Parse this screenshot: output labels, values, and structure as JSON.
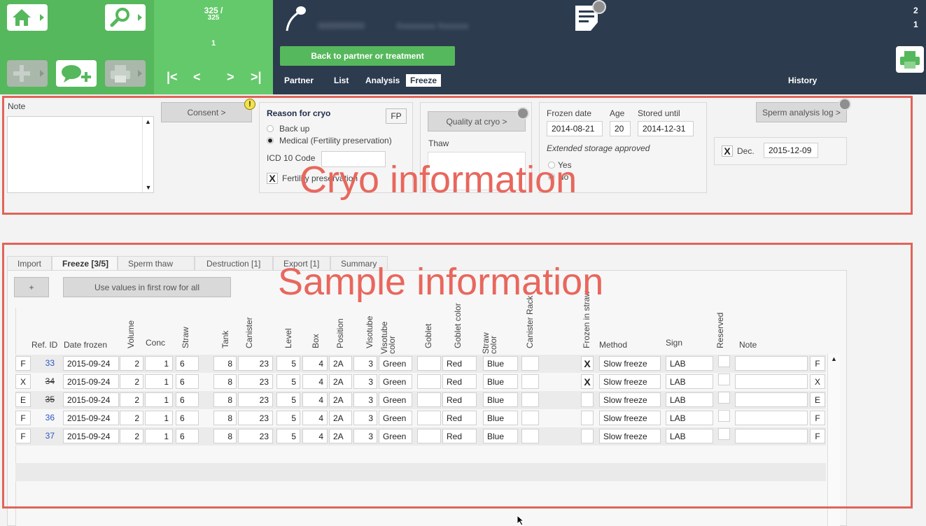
{
  "nav": {
    "counter_top": "325 /",
    "counter_total": "325",
    "counter_current": "1",
    "first_icon": "first-page-icon",
    "prev_icon": "prev-page-icon",
    "next_icon": "next-page-icon",
    "last_icon": "last-page-icon"
  },
  "header": {
    "back_button": "Back to partner or treatment",
    "tabs": [
      "Partner",
      "List",
      "Analysis",
      "Freeze"
    ],
    "active_tab": "Freeze",
    "history": "History",
    "right_numbers": [
      "2",
      "1"
    ]
  },
  "cryo": {
    "note_label": "Note",
    "consent_button": "Consent >",
    "warning_glyph": "!",
    "reason_title": "Reason for cryo",
    "fp_button": "FP",
    "reason_options": [
      "Back up",
      "Medical (Fertility preservation)"
    ],
    "reason_selected": 1,
    "icd_label": "ICD 10 Code",
    "icd_value": "",
    "fertility_label": "Fertility preservation",
    "fertility_checked": "X",
    "quality_button": "Quality at cryo >",
    "thaw_label": "Thaw",
    "frozen_date_label": "Frozen date",
    "frozen_date": "2014-08-21",
    "age_label": "Age",
    "age_value": "20",
    "stored_until_label": "Stored until",
    "stored_until": "2014-12-31",
    "extended_label": "Extended storage approved",
    "extended_options": [
      "Yes",
      "No"
    ],
    "extended_selected": 1,
    "sperm_log_button": "Sperm analysis log >",
    "dec_checked": "X",
    "dec_label": "Dec.",
    "dec_date": "2015-12-09"
  },
  "overlays": {
    "cryo_title": "Cryo information",
    "sample_title": "Sample information"
  },
  "sample": {
    "tabs": [
      "Import",
      "Freeze [3/5]",
      "Sperm thaw",
      "Destruction [1]",
      "Export [1]",
      "Summary"
    ],
    "active_tab": "Freeze [3/5]",
    "add_button": "+",
    "use_values_button": "Use values in first row for all",
    "columns": {
      "ref_id": "Ref. ID",
      "date_frozen": "Date frozen",
      "volume": "Volume",
      "conc": "Conc",
      "straw": "Straw",
      "tank": "Tank",
      "canister": "Canister",
      "level": "Level",
      "box": "Box",
      "position": "Position",
      "visotube": "Visotube",
      "visotube_color": "Visotube color",
      "goblet": "Goblet",
      "goblet_color": "Goblet color",
      "straw_color": "Straw color",
      "canister_rack": "Canister Rack",
      "frozen_in_straw": "Frozen in straw",
      "method": "Method",
      "sign": "Sign",
      "reserved": "Reserved",
      "note": "Note"
    },
    "rows": [
      {
        "flag": "F",
        "ref": "33",
        "ref_style": "link",
        "date": "2015-09-24",
        "volume": "2",
        "conc": "1",
        "straw": "6",
        "tank": "8",
        "canister": "23",
        "level": "5",
        "box": "4",
        "position": "2A",
        "visotube": "3",
        "visotube_color": "Green",
        "goblet": "",
        "goblet_color": "Red",
        "straw_color": "Blue",
        "canister_rack": "",
        "frozen": "X",
        "method": "Slow freeze",
        "sign": "LAB",
        "reserved": "",
        "note": "",
        "end_flag": "F"
      },
      {
        "flag": "X",
        "ref": "34",
        "ref_style": "struck",
        "date": "2015-09-24",
        "volume": "2",
        "conc": "1",
        "straw": "6",
        "tank": "8",
        "canister": "23",
        "level": "5",
        "box": "4",
        "position": "2A",
        "visotube": "3",
        "visotube_color": "Green",
        "goblet": "",
        "goblet_color": "Red",
        "straw_color": "Blue",
        "canister_rack": "",
        "frozen": "X",
        "method": "Slow freeze",
        "sign": "LAB",
        "reserved": "",
        "note": "",
        "end_flag": "X"
      },
      {
        "flag": "E",
        "ref": "35",
        "ref_style": "struck",
        "date": "2015-09-24",
        "volume": "2",
        "conc": "1",
        "straw": "6",
        "tank": "8",
        "canister": "23",
        "level": "5",
        "box": "4",
        "position": "2A",
        "visotube": "3",
        "visotube_color": "Green",
        "goblet": "",
        "goblet_color": "Red",
        "straw_color": "Blue",
        "canister_rack": "",
        "frozen": "",
        "method": "Slow freeze",
        "sign": "LAB",
        "reserved": "",
        "note": "",
        "end_flag": "E"
      },
      {
        "flag": "F",
        "ref": "36",
        "ref_style": "link",
        "date": "2015-09-24",
        "volume": "2",
        "conc": "1",
        "straw": "6",
        "tank": "8",
        "canister": "23",
        "level": "5",
        "box": "4",
        "position": "2A",
        "visotube": "3",
        "visotube_color": "Green",
        "goblet": "",
        "goblet_color": "Red",
        "straw_color": "Blue",
        "canister_rack": "",
        "frozen": "",
        "method": "Slow freeze",
        "sign": "LAB",
        "reserved": "",
        "note": "",
        "end_flag": "F"
      },
      {
        "flag": "F",
        "ref": "37",
        "ref_style": "link",
        "date": "2015-09-24",
        "volume": "2",
        "conc": "1",
        "straw": "6",
        "tank": "8",
        "canister": "23",
        "level": "5",
        "box": "4",
        "position": "2A",
        "visotube": "3",
        "visotube_color": "Green",
        "goblet": "",
        "goblet_color": "Red",
        "straw_color": "Blue",
        "canister_rack": "",
        "frozen": "",
        "method": "Slow freeze",
        "sign": "LAB",
        "reserved": "",
        "note": "",
        "end_flag": "F"
      }
    ]
  },
  "colors": {
    "green": "#56b85c",
    "green_light": "#64c96a",
    "navy": "#2c3b4e",
    "annotation_red": "#e0645a",
    "link_blue": "#2a55c4"
  }
}
